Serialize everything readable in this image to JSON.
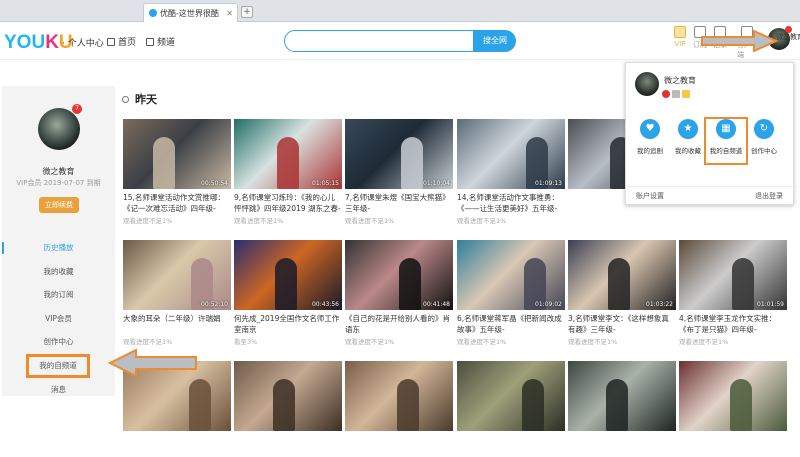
{
  "browser": {
    "tab_title": "优酷-这世界很酷",
    "new_tab": "+"
  },
  "header": {
    "logo": "YOUKU",
    "subtitle": "· 个人中心",
    "nav": [
      {
        "label": "首页",
        "icon": "home-icon"
      },
      {
        "label": "频道",
        "icon": "grid-icon"
      }
    ],
    "search_placeholder": "",
    "search_button": "搜全网",
    "top_icons": [
      {
        "label": "VIP",
        "icon": "crown-icon"
      },
      {
        "label": "订阅",
        "icon": "subscribe-icon"
      },
      {
        "label": "记录",
        "icon": "history-icon"
      },
      {
        "label": "客户端",
        "icon": "client-icon"
      }
    ],
    "user_label": "微之教育"
  },
  "sidebar": {
    "badge": "7",
    "name": "微之教育",
    "vip": "VIP会员 2019-07-07 到期",
    "renew_button": "立即续费",
    "menu": [
      "历史播放",
      "我的收藏",
      "我的订阅",
      "VIP会员",
      "创作中心",
      "我的自频道",
      "消息"
    ]
  },
  "section_title": "昨天",
  "videos": [
    {
      "title": "15,名师课堂活动作文赏推哪：《记一次难忘活动》四年级-",
      "duration": "00:50:54",
      "progress": "观看进度不足1%",
      "colors": [
        "#7a6b5c",
        "#3b3f45",
        "#c9b9a5"
      ]
    },
    {
      "title": "9,名师课堂习炼玲：《我的心儿怦怦跳》四年级2019 湖东之春-",
      "duration": "01:05:15",
      "progress": "观看进度不足1%",
      "colors": [
        "#1e6f66",
        "#d8e2e0",
        "#a33"
      ]
    },
    {
      "title": "7,名师课堂朱煜《国宝大熊猫》三年级-",
      "duration": "01:10:04",
      "progress": "观看进度不足1%",
      "colors": [
        "#37495a",
        "#1d2a36",
        "#c8cdd3"
      ]
    },
    {
      "title": "14,名师课堂活动作文事推勇：《——让生活更美好》五年级-",
      "duration": "01:09:13",
      "progress": "观看进度不足1%",
      "colors": [
        "#5a6c78",
        "#cfd6dc",
        "#2c3b48"
      ]
    },
    {
      "title": "",
      "duration": "",
      "progress": "",
      "colors": [
        "#4a4d52",
        "#b8bec6",
        "#262a30"
      ]
    },
    {
      "title": "",
      "duration": "",
      "progress": "",
      "colors": [
        "#244a45",
        "#8aa4a0",
        "#c8d0d2"
      ]
    },
    {
      "title": "大象的耳朵（二年级）许瑞娟",
      "duration": "00:52:10",
      "progress": "观看进度不足1%",
      "colors": [
        "#6a5a48",
        "#d9c9a9",
        "#a88"
      ]
    },
    {
      "title": "何先成_2019全国作文名师工作室南京",
      "duration": "00:43:56",
      "progress": "看至3%",
      "colors": [
        "#2a2f6e",
        "#c62",
        "#1a1a2a"
      ]
    },
    {
      "title": "《自己的花是开给别人看的》肖语东",
      "duration": "00:41:48",
      "progress": "观看进度不足1%",
      "colors": [
        "#333",
        "#b88",
        "#111"
      ]
    },
    {
      "title": "6,名师课堂蒋军晶《把新闻改成故事》五年级-",
      "duration": "01:09:02",
      "progress": "观看进度不足1%",
      "colors": [
        "#2f7f9e",
        "#d8c8b4",
        "#445"
      ]
    },
    {
      "title": "3,名师课堂李文：《这样想象真有趣》三年级-",
      "duration": "01:03:22",
      "progress": "观看进度不足1%",
      "colors": [
        "#3a3f55",
        "#d9c6b0",
        "#222"
      ]
    },
    {
      "title": "4,名师课堂李玉龙作文实推：《布丁是只猫》四年级-",
      "duration": "01:01:59",
      "progress": "观看进度不足1%",
      "colors": [
        "#5a4a3c",
        "#ccc",
        "#333"
      ]
    },
    {
      "title": "",
      "duration": "",
      "progress": "",
      "colors": [
        "#9a7a5c",
        "#d7c0a0",
        "#6a4f3a"
      ]
    },
    {
      "title": "",
      "duration": "",
      "progress": "",
      "colors": [
        "#6e5b4a",
        "#c4a890",
        "#3c2f25"
      ]
    },
    {
      "title": "",
      "duration": "",
      "progress": "",
      "colors": [
        "#7a5d48",
        "#d2b698",
        "#4a3a2c"
      ]
    },
    {
      "title": "",
      "duration": "",
      "progress": "",
      "colors": [
        "#4b4f3c",
        "#9ea07a",
        "#2b2e24"
      ]
    },
    {
      "title": "",
      "duration": "",
      "progress": "",
      "colors": [
        "#3d4742",
        "#a8b2a8",
        "#1e2522"
      ]
    },
    {
      "title": "",
      "duration": "",
      "progress": "",
      "colors": [
        "#6a3030",
        "#e2d3c8",
        "#4a5a3a"
      ]
    }
  ],
  "popup": {
    "name": "微之教育",
    "actions": [
      {
        "label": "我的追剧",
        "icon": "heart-icon"
      },
      {
        "label": "我的收藏",
        "icon": "star-icon"
      },
      {
        "label": "我的自频道",
        "icon": "channel-icon"
      },
      {
        "label": "创作中心",
        "icon": "create-icon"
      }
    ],
    "account_settings": "账户设置",
    "logout": "退出登录"
  },
  "accent": "#2aa3e8",
  "highlight": "#f08a2c"
}
